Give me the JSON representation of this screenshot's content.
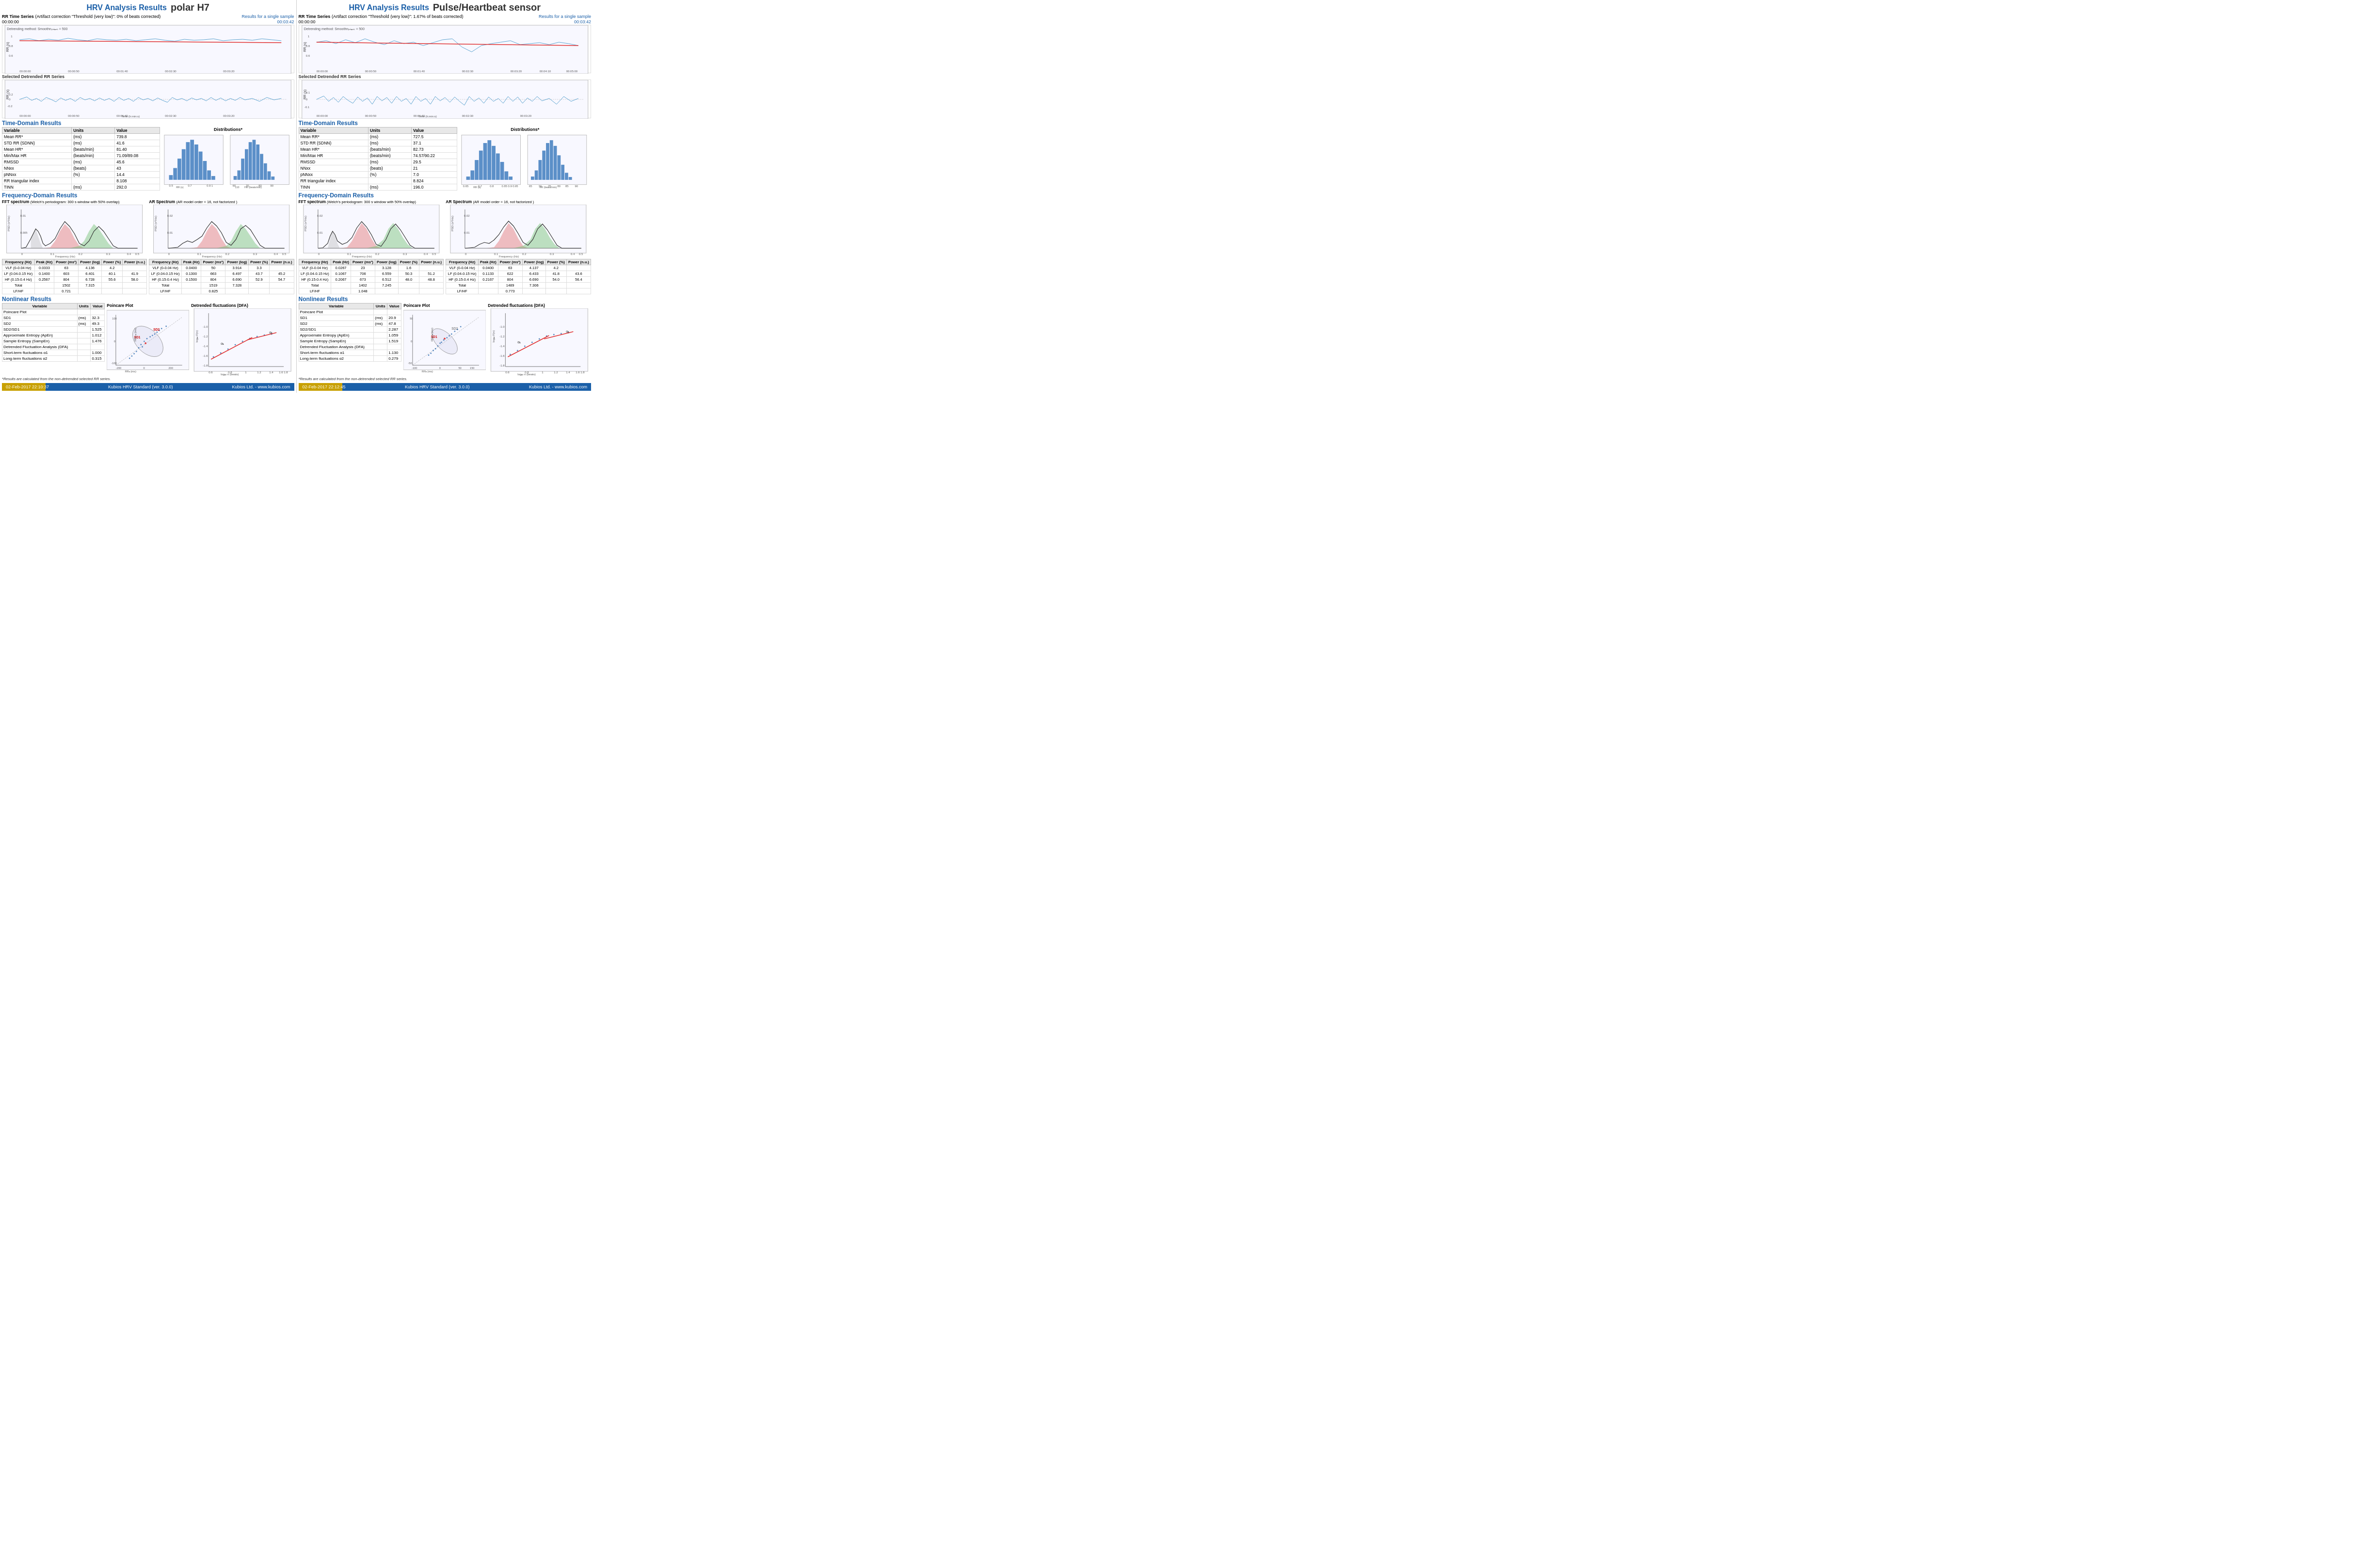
{
  "panels": [
    {
      "id": "polar",
      "hrv_title": "HRV Analysis Results",
      "sensor_title": "polar H7",
      "rr_series_title": "RR Time Series",
      "rr_artifact_info": "(Artifact correction \"Threshold (very low)\": 0% of beats corrected)",
      "rr_time_start": "00:00:00",
      "rr_time_end": "00:03:42",
      "results_label": "Results for a single sample",
      "detrend_method": "Detrending method: Smoothn priora = 500",
      "detrended_title": "Selected Detrended RR Series",
      "time_domain_title": "Time-Domain Results",
      "distributions_title": "Distributions*",
      "variables": [
        {
          "name": "Mean RR*",
          "units": "(ms)",
          "value": "739.8"
        },
        {
          "name": "STD RR (SDNN)",
          "units": "(ms)",
          "value": "41.6"
        },
        {
          "name": "Mean HR*",
          "units": "(beats/min)",
          "value": "81.40"
        },
        {
          "name": "Min/Max HR",
          "units": "(beats/min)",
          "value": "71.09/89.08"
        },
        {
          "name": "RMSSD",
          "units": "(ms)",
          "value": "45.6"
        },
        {
          "name": "NNxx",
          "units": "(beats)",
          "value": "43"
        },
        {
          "name": "pNNxx",
          "units": "(%)",
          "value": "14.4"
        },
        {
          "name": "RR triangular index",
          "units": "",
          "value": "8.108"
        },
        {
          "name": "TINN",
          "units": "(ms)",
          "value": "292.0"
        }
      ],
      "freq_title": "Frequency-Domain Results",
      "fft_title": "FFT spectrum",
      "fft_subtitle": "(Welch's periodogram: 300 s window with 50% overlap)",
      "ar_title": "AR Spectrum",
      "ar_subtitle": "(AR model order = 16, not factorized )",
      "freq_table_left": [
        {
          "band": "VLF (0-0.04 Hz)",
          "peak": "0.0333",
          "power_ms2": "63",
          "power_log": "4.136",
          "power_pct": "4.2",
          "power_nu": ""
        },
        {
          "band": "LF (0.04-0.15 Hz)",
          "peak": "0.1400",
          "power_ms2": "603",
          "power_log": "6.401",
          "power_pct": "40.1",
          "power_nu": "41.9"
        },
        {
          "band": "HF (0.15-0.4 Hz)",
          "peak": "0.2567",
          "power_ms2": "804",
          "power_log": "6.728",
          "power_pct": "55.6",
          "power_nu": "58.0"
        },
        {
          "band": "Total",
          "peak": "",
          "power_ms2": "1502",
          "power_log": "7.315",
          "power_pct": "",
          "power_nu": ""
        },
        {
          "band": "LF/HF",
          "peak": "",
          "power_ms2": "0.721",
          "power_log": "",
          "power_pct": "",
          "power_nu": ""
        }
      ],
      "freq_table_right": [
        {
          "band": "VLF (0-0.04 Hz)",
          "peak": "0.0400",
          "power_ms2": "50",
          "power_log": "3.914",
          "power_pct": "3.3",
          "power_nu": ""
        },
        {
          "band": "LF (0.04-0.15 Hz)",
          "peak": "0.1300",
          "power_ms2": "663",
          "power_log": "6.497",
          "power_pct": "43.7",
          "power_nu": "45.2"
        },
        {
          "band": "HF (0.15-0.4 Hz)",
          "peak": "0.1500",
          "power_ms2": "804",
          "power_log": "6.690",
          "power_pct": "52.9",
          "power_nu": "54.7"
        },
        {
          "band": "Total",
          "peak": "",
          "power_ms2": "1519",
          "power_log": "7.328",
          "power_pct": "",
          "power_nu": ""
        },
        {
          "band": "LF/HF",
          "peak": "",
          "power_ms2": "0.825",
          "power_log": "",
          "power_pct": "",
          "power_nu": ""
        }
      ],
      "nonlinear_title": "Nonlinear Results",
      "nonlinear_vars": [
        {
          "name": "Poincare Plot",
          "units": "",
          "value": ""
        },
        {
          "name": "SD1",
          "units": "(ms)",
          "value": "32.3"
        },
        {
          "name": "SD2",
          "units": "(ms)",
          "value": "49.3"
        },
        {
          "name": "SD2/SD1",
          "units": "",
          "value": "1.525"
        },
        {
          "name": "Approximate Entropy (ApEn)",
          "units": "",
          "value": "1.012"
        },
        {
          "name": "Sample Entropy (SampEn)",
          "units": "",
          "value": "1.476"
        },
        {
          "name": "Detrended Fluctuation Analysis (DFA)",
          "units": "",
          "value": ""
        },
        {
          "name": "Short-term fluctuations α1",
          "units": "",
          "value": "1.000"
        },
        {
          "name": "Long-term fluctuations α2",
          "units": "",
          "value": "0.315"
        }
      ],
      "poincare_title": "Poincare Plot",
      "dfa_title": "Detrended fluctuations (DFA)",
      "footnote": "*Results are calculated from the non-detrended selected RR series.",
      "footer_date": "02-Feb-2017 22:10:37",
      "footer_software": "Kubios HRV Standard (ver. 3.0.0)",
      "footer_company": "Kubios Ltd. - www.kubios.com"
    },
    {
      "id": "pulse",
      "hrv_title": "HRV Analysis Results",
      "sensor_title": "Pulse/Heartbeat sensor",
      "rr_series_title": "RR Time Series",
      "rr_artifact_info": "(Artifact correction \"Threshold (very low)\": 1.67% of beats corrected)",
      "rr_time_start": "00:00:00",
      "rr_time_end": "00:03:42",
      "results_label": "Results for a single sample",
      "detrend_method": "Detrending method: Smoothn priora = 500",
      "detrended_title": "Selected Detrended RR Series",
      "time_domain_title": "Time-Domain Results",
      "distributions_title": "Distributions*",
      "variables": [
        {
          "name": "Mean RR*",
          "units": "(ms)",
          "value": "727.5"
        },
        {
          "name": "STD RR (SDNN)",
          "units": "(ms)",
          "value": "37.1"
        },
        {
          "name": "Mean HR*",
          "units": "(beats/min)",
          "value": "82.73"
        },
        {
          "name": "Min/Max HR",
          "units": "(beats/min)",
          "value": "74.57/90.22"
        },
        {
          "name": "RMSSD",
          "units": "(ms)",
          "value": "29.5"
        },
        {
          "name": "NNxx",
          "units": "(beats)",
          "value": "21"
        },
        {
          "name": "pNNxx",
          "units": "(%)",
          "value": "7.0"
        },
        {
          "name": "RR triangular index",
          "units": "",
          "value": "8.824"
        },
        {
          "name": "TINN",
          "units": "(ms)",
          "value": "196.0"
        }
      ],
      "freq_title": "Frequency-Domain Results",
      "fft_title": "FFT spectrum",
      "fft_subtitle": "(Welch's periodogram: 300 s window with 50% overlap)",
      "ar_title": "AR Spectrum",
      "ar_subtitle": "(AR model order = 16, not factorized )",
      "freq_table_left": [
        {
          "band": "VLF (0-0.04 Hz)",
          "peak": "0.0267",
          "power_ms2": "23",
          "power_log": "3.128",
          "power_pct": "1.6",
          "power_nu": ""
        },
        {
          "band": "LF (0.04-0.15 Hz)",
          "peak": "0.1067",
          "power_ms2": "706",
          "power_log": "6.559",
          "power_pct": "50.3",
          "power_nu": "51.2"
        },
        {
          "band": "HF (0.15-0.4 Hz)",
          "peak": "0.2067",
          "power_ms2": "673",
          "power_log": "6.512",
          "power_pct": "48.0",
          "power_nu": "48.8"
        },
        {
          "band": "Total",
          "peak": "",
          "power_ms2": "1402",
          "power_log": "7.245",
          "power_pct": "",
          "power_nu": ""
        },
        {
          "band": "LF/HF",
          "peak": "",
          "power_ms2": "1.048",
          "power_log": "",
          "power_pct": "",
          "power_nu": ""
        }
      ],
      "freq_table_right": [
        {
          "band": "VLF (0-0.04 Hz)",
          "peak": "0.0400",
          "power_ms2": "63",
          "power_log": "4.137",
          "power_pct": "4.2",
          "power_nu": ""
        },
        {
          "band": "LF (0.04-0.15 Hz)",
          "peak": "0.1133",
          "power_ms2": "622",
          "power_log": "6.433",
          "power_pct": "41.8",
          "power_nu": "43.6"
        },
        {
          "band": "HF (0.15-0.4 Hz)",
          "peak": "0.2167",
          "power_ms2": "804",
          "power_log": "6.690",
          "power_pct": "54.0",
          "power_nu": "56.4"
        },
        {
          "band": "Total",
          "peak": "",
          "power_ms2": "1489",
          "power_log": "7.306",
          "power_pct": "",
          "power_nu": ""
        },
        {
          "band": "LF/HF",
          "peak": "",
          "power_ms2": "0.773",
          "power_log": "",
          "power_pct": "",
          "power_nu": ""
        }
      ],
      "nonlinear_title": "Nonlinear Results",
      "nonlinear_vars": [
        {
          "name": "Poincare Plot",
          "units": "",
          "value": ""
        },
        {
          "name": "SD1",
          "units": "(ms)",
          "value": "20.9"
        },
        {
          "name": "SD2",
          "units": "(ms)",
          "value": "47.8"
        },
        {
          "name": "SD2/SD1",
          "units": "",
          "value": "2.287"
        },
        {
          "name": "Approximate Entropy (ApEn)",
          "units": "",
          "value": "1.059"
        },
        {
          "name": "Sample Entropy (SampEn)",
          "units": "",
          "value": "1.519"
        },
        {
          "name": "Detrended Fluctuation Analysis (DFA)",
          "units": "",
          "value": ""
        },
        {
          "name": "Short-term fluctuations α1",
          "units": "",
          "value": "1.130"
        },
        {
          "name": "Long-term fluctuations α2",
          "units": "",
          "value": "0.279"
        }
      ],
      "poincare_title": "Poincare Plot",
      "dfa_title": "Detrended fluctuations (DFA)",
      "footnote": "*Results are calculated from the non-detrended selected RR series.",
      "footer_date": "02-Feb-2017 22:12:45",
      "footer_software": "Kubios HRV Standard (ver. 3.0.0)",
      "footer_company": "Kubios Ltd. - www.kubios.com"
    }
  ],
  "colors": {
    "blue_title": "#1a5fa8",
    "gold": "#c8a000",
    "chart_line": "#5ba3d0",
    "chart_red": "#e03030",
    "vlf_fill": "#f0f0f0",
    "lf_fill": "#e88080",
    "hf_fill": "#80c880",
    "bar_fill": "#5b8fc8"
  }
}
